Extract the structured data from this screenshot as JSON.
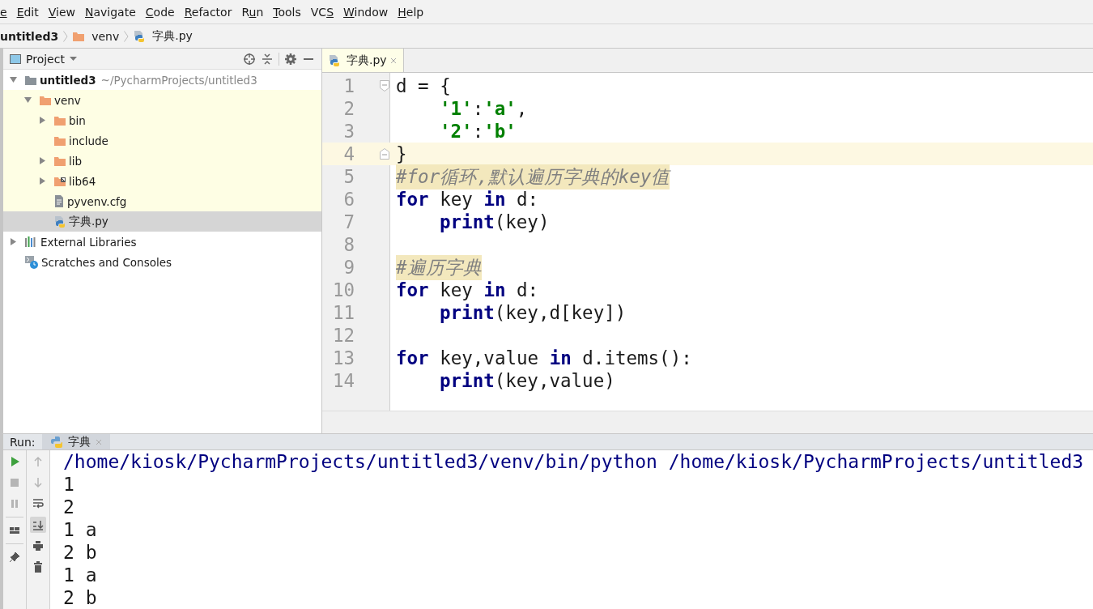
{
  "menu": [
    {
      "key": "e"
    },
    {
      "key": "E",
      "post": "dit"
    },
    {
      "key": "V",
      "post": "iew"
    },
    {
      "key": "N",
      "post": "avigate"
    },
    {
      "key": "C",
      "post": "ode"
    },
    {
      "key": "R",
      "post": "efactor"
    },
    {
      "pre": "R",
      "key": "u",
      "post": "n"
    },
    {
      "key": "T",
      "post": "ools"
    },
    {
      "pre": "VC",
      "key": "S"
    },
    {
      "key": "W",
      "post": "indow"
    },
    {
      "key": "H",
      "post": "elp"
    }
  ],
  "breadcrumb": [
    {
      "label": "untitled3",
      "kind": "project"
    },
    {
      "label": "venv",
      "kind": "folder"
    },
    {
      "label": "字典.py",
      "kind": "python"
    }
  ],
  "project_panel": {
    "title": "Project",
    "tree": [
      {
        "label": "untitled3",
        "detail": "~/PycharmProjects/untitled3",
        "kind": "project",
        "expanded": true,
        "selected": false,
        "tinted": false,
        "children": [
          {
            "label": "venv",
            "kind": "folder",
            "expanded": true,
            "selected": false,
            "tinted": true,
            "children": [
              {
                "label": "bin",
                "kind": "folder",
                "expanded": false,
                "selected": false,
                "tinted": true
              },
              {
                "label": "include",
                "kind": "folder",
                "selected": false,
                "tinted": true
              },
              {
                "label": "lib",
                "kind": "folder",
                "expanded": false,
                "selected": false,
                "tinted": true
              },
              {
                "label": "lib64",
                "kind": "link-folder",
                "expanded": false,
                "selected": false,
                "tinted": true
              },
              {
                "label": "pyvenv.cfg",
                "kind": "text",
                "selected": false,
                "tinted": true
              },
              {
                "label": "字典.py",
                "kind": "python",
                "selected": true,
                "tinted": true
              }
            ]
          }
        ]
      },
      {
        "label": "External Libraries",
        "kind": "libraries",
        "expanded": false,
        "selected": false,
        "tinted": false
      },
      {
        "label": "Scratches and Consoles",
        "kind": "scratches",
        "selected": false,
        "tinted": false
      }
    ]
  },
  "editor": {
    "tabs": [
      {
        "label": "字典.py",
        "selected": true
      }
    ],
    "lines": [
      {
        "number": "1",
        "current": false,
        "indented": false,
        "kind": "fold-start",
        "tokens": [
          {
            "kind": "plain",
            "text": "d = {"
          }
        ]
      },
      {
        "number": "2",
        "current": false,
        "indented": true,
        "kind": "code",
        "tokens": [
          {
            "kind": "string",
            "text": "'1'"
          },
          {
            "kind": "plain",
            "text": ":"
          },
          {
            "kind": "string",
            "text": "'a'"
          },
          {
            "kind": "plain",
            "text": ","
          }
        ]
      },
      {
        "number": "3",
        "current": false,
        "indented": true,
        "kind": "code",
        "tokens": [
          {
            "kind": "string",
            "text": "'2'"
          },
          {
            "kind": "plain",
            "text": ":"
          },
          {
            "kind": "string",
            "text": "'b'"
          }
        ]
      },
      {
        "number": "4",
        "current": true,
        "indented": false,
        "kind": "fold-end",
        "tokens": [
          {
            "kind": "plain",
            "text": "}"
          }
        ]
      },
      {
        "number": "5",
        "current": false,
        "indented": false,
        "kind": "code",
        "tokens": [
          {
            "kind": "comment",
            "text": "#for循环,默认遍历字典的key值"
          }
        ]
      },
      {
        "number": "6",
        "current": false,
        "indented": false,
        "kind": "code",
        "tokens": [
          {
            "kind": "keyword",
            "text": "for"
          },
          {
            "kind": "plain",
            "text": " key "
          },
          {
            "kind": "keyword",
            "text": "in"
          },
          {
            "kind": "plain",
            "text": " d:"
          }
        ]
      },
      {
        "number": "7",
        "current": false,
        "indented": true,
        "kind": "code",
        "tokens": [
          {
            "kind": "keyword",
            "text": "print"
          },
          {
            "kind": "plain",
            "text": "(key)"
          }
        ]
      },
      {
        "number": "8",
        "current": false,
        "kind": "code"
      },
      {
        "number": "9",
        "current": false,
        "indented": false,
        "kind": "code",
        "tokens": [
          {
            "kind": "comment",
            "text": "#遍历字典"
          }
        ]
      },
      {
        "number": "10",
        "current": false,
        "indented": false,
        "kind": "code",
        "tokens": [
          {
            "kind": "keyword",
            "text": "for"
          },
          {
            "kind": "plain",
            "text": " key "
          },
          {
            "kind": "keyword",
            "text": "in"
          },
          {
            "kind": "plain",
            "text": " d:"
          }
        ]
      },
      {
        "number": "11",
        "current": false,
        "indented": true,
        "kind": "code",
        "tokens": [
          {
            "kind": "keyword",
            "text": "print"
          },
          {
            "kind": "plain",
            "text": "(key,d[key])"
          }
        ]
      },
      {
        "number": "12",
        "current": false,
        "kind": "code"
      },
      {
        "number": "13",
        "current": false,
        "indented": false,
        "kind": "code",
        "tokens": [
          {
            "kind": "keyword",
            "text": "for"
          },
          {
            "kind": "plain",
            "text": " key,value "
          },
          {
            "kind": "keyword",
            "text": "in"
          },
          {
            "kind": "plain",
            "text": " d.items():"
          }
        ]
      },
      {
        "number": "14",
        "current": false,
        "indented": true,
        "kind": "code",
        "tokens": [
          {
            "kind": "keyword",
            "text": "print"
          },
          {
            "kind": "plain",
            "text": "(key,value)"
          }
        ]
      }
    ]
  },
  "run_panel": {
    "label": "Run:",
    "tabs": [
      {
        "label": "字典",
        "selected": true
      }
    ],
    "left_tools": [
      {
        "kind": "run",
        "disabled": false
      },
      {
        "kind": "stop",
        "disabled": true
      },
      {
        "kind": "pause",
        "disabled": true
      },
      {
        "kind": "layout",
        "disabled": false
      },
      {
        "kind": "pin",
        "disabled": false
      }
    ],
    "right_tools": [
      {
        "kind": "up",
        "disabled": true,
        "selected": false
      },
      {
        "kind": "down",
        "disabled": true,
        "selected": false
      },
      {
        "kind": "wrap",
        "disabled": false,
        "selected": false
      },
      {
        "kind": "scroll-end",
        "disabled": false,
        "selected": true
      },
      {
        "kind": "print",
        "disabled": false,
        "selected": false
      },
      {
        "kind": "trash",
        "disabled": false,
        "selected": false
      }
    ],
    "output": [
      {
        "kind": "command",
        "text": "/home/kiosk/PycharmProjects/untitled3/venv/bin/python /home/kiosk/PycharmProjects/untitled3"
      },
      {
        "kind": "stdout",
        "text": "1"
      },
      {
        "kind": "stdout",
        "text": "2"
      },
      {
        "kind": "stdout",
        "text": "1 a"
      },
      {
        "kind": "stdout",
        "text": "2 b"
      },
      {
        "kind": "stdout",
        "text": "1 a"
      },
      {
        "kind": "stdout",
        "text": "2 b"
      }
    ]
  }
}
